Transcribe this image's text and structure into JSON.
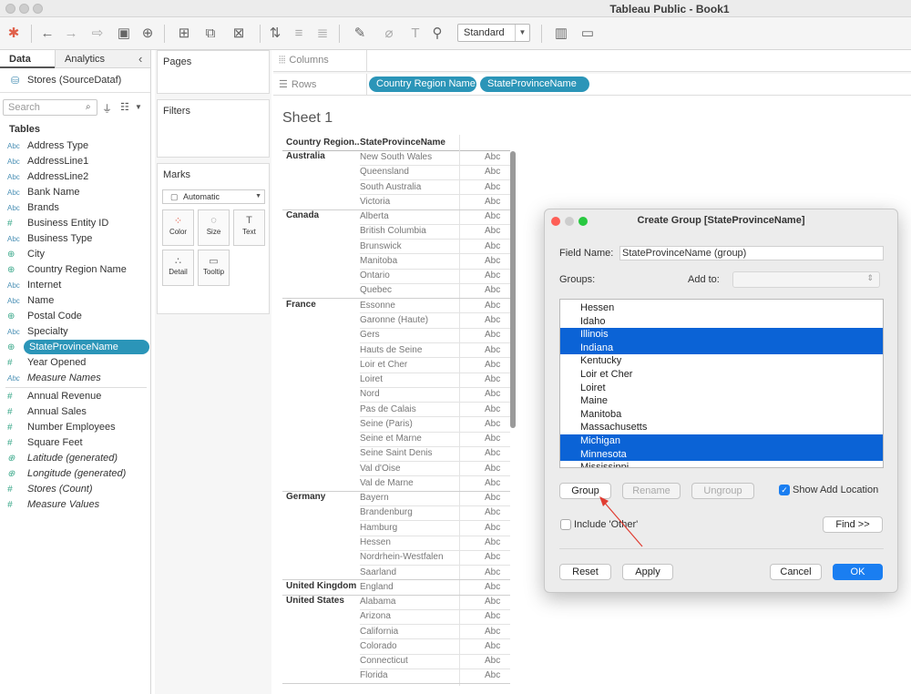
{
  "window": {
    "title": "Tableau Public - Book1"
  },
  "toolbar": {
    "view_size": "Standard"
  },
  "left_panel": {
    "tabs": [
      "Data",
      "Analytics"
    ],
    "datasource": "Stores (SourceDataf)",
    "search_placeholder": "Search",
    "tables_header": "Tables",
    "dimensions": [
      {
        "type": "Abc",
        "name": "Address Type"
      },
      {
        "type": "Abc",
        "name": "AddressLine1"
      },
      {
        "type": "Abc",
        "name": "AddressLine2"
      },
      {
        "type": "Abc",
        "name": "Bank Name"
      },
      {
        "type": "Abc",
        "name": "Brands"
      },
      {
        "type": "#",
        "name": "Business Entity ID"
      },
      {
        "type": "Abc",
        "name": "Business Type"
      },
      {
        "type": "globe",
        "name": "City"
      },
      {
        "type": "globe",
        "name": "Country Region Name"
      },
      {
        "type": "Abc",
        "name": "Internet"
      },
      {
        "type": "Abc",
        "name": "Name"
      },
      {
        "type": "globe",
        "name": "Postal Code"
      },
      {
        "type": "Abc",
        "name": "Specialty"
      },
      {
        "type": "globe",
        "name": "StateProvinceName"
      },
      {
        "type": "#",
        "name": "Year Opened"
      },
      {
        "type": "Abc",
        "name": "Measure Names"
      }
    ],
    "measures": [
      {
        "type": "#",
        "name": "Annual Revenue"
      },
      {
        "type": "#",
        "name": "Annual Sales"
      },
      {
        "type": "#",
        "name": "Number Employees"
      },
      {
        "type": "#",
        "name": "Square Feet"
      },
      {
        "type": "globe",
        "name": "Latitude (generated)"
      },
      {
        "type": "globe",
        "name": "Longitude (generated)"
      },
      {
        "type": "#",
        "name": "Stores (Count)"
      },
      {
        "type": "#",
        "name": "Measure Values"
      }
    ]
  },
  "cards": {
    "pages": "Pages",
    "filters": "Filters",
    "marks": "Marks",
    "mark_type": "Automatic",
    "mark_buttons": [
      "Color",
      "Size",
      "Text",
      "Detail",
      "Tooltip"
    ]
  },
  "shelves": {
    "columns": "Columns",
    "rows": "Rows",
    "row_pills": [
      "Country Region Name",
      "StateProvinceName"
    ]
  },
  "sheet": {
    "title": "Sheet 1",
    "col_headers": [
      "Country Region..",
      "StateProvinceName"
    ],
    "cell_text": "Abc",
    "groups": [
      {
        "country": "Australia",
        "states": [
          "New South Wales",
          "Queensland",
          "South Australia",
          "Victoria"
        ]
      },
      {
        "country": "Canada",
        "states": [
          "Alberta",
          "British Columbia",
          "Brunswick",
          "Manitoba",
          "Ontario",
          "Quebec"
        ]
      },
      {
        "country": "France",
        "states": [
          "Essonne",
          "Garonne (Haute)",
          "Gers",
          "Hauts de Seine",
          "Loir et Cher",
          "Loiret",
          "Nord",
          "Pas de Calais",
          "Seine (Paris)",
          "Seine et Marne",
          "Seine Saint Denis",
          "Val d'Oise",
          "Val de Marne"
        ]
      },
      {
        "country": "Germany",
        "states": [
          "Bayern",
          "Brandenburg",
          "Hamburg",
          "Hessen",
          "Nordrhein-Westfalen",
          "Saarland"
        ]
      },
      {
        "country": "United Kingdom",
        "states": [
          "England"
        ]
      },
      {
        "country": "United States",
        "states": [
          "Alabama",
          "Arizona",
          "California",
          "Colorado",
          "Connecticut",
          "Florida"
        ]
      }
    ]
  },
  "dialog": {
    "title": "Create Group [StateProvinceName]",
    "field_name_label": "Field Name:",
    "field_name_value": "StateProvinceName (group)",
    "groups_label": "Groups:",
    "add_to_label": "Add to:",
    "items": [
      {
        "name": "Hessen",
        "selected": false
      },
      {
        "name": "Idaho",
        "selected": false
      },
      {
        "name": "Illinois",
        "selected": true
      },
      {
        "name": "Indiana",
        "selected": true
      },
      {
        "name": "Kentucky",
        "selected": false
      },
      {
        "name": "Loir et Cher",
        "selected": false
      },
      {
        "name": "Loiret",
        "selected": false
      },
      {
        "name": "Maine",
        "selected": false
      },
      {
        "name": "Manitoba",
        "selected": false
      },
      {
        "name": "Massachusetts",
        "selected": false
      },
      {
        "name": "Michigan",
        "selected": true
      },
      {
        "name": "Minnesota",
        "selected": true
      },
      {
        "name": "Mississippi",
        "selected": false
      }
    ],
    "group_btn": "Group",
    "rename_btn": "Rename",
    "ungroup_btn": "Ungroup",
    "show_add_location": "Show Add Location",
    "include_other": "Include 'Other'",
    "find_btn": "Find >>",
    "reset_btn": "Reset",
    "apply_btn": "Apply",
    "cancel_btn": "Cancel",
    "ok_btn": "OK"
  },
  "colors": {
    "accent": "#2b95b8",
    "selection": "#0b63d6",
    "primary_button": "#1a7ef1",
    "annotation_arrow": "#e03c31"
  }
}
